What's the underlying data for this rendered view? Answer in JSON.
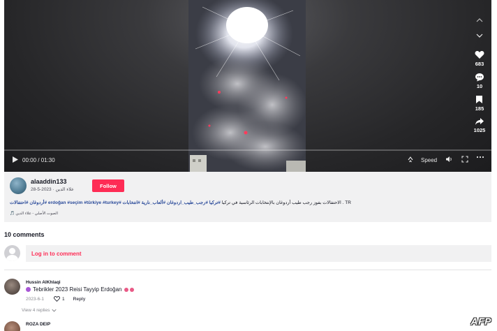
{
  "video": {
    "time_display": "00:00 / 01:30",
    "speed_label": "Speed",
    "progress": 0.0
  },
  "actions": {
    "likes": "683",
    "comments": "10",
    "saves": "185",
    "shares": "1025"
  },
  "author": {
    "username": "alaaddin133",
    "nickname_date": "علاء الدين · 2023-5-28",
    "follow_label": "Follow",
    "description_prefix": "TR . الاحتفالات بفوز رجب طيب أردوغان بالإنتخابات الرئاسية في تركيا",
    "hashtags": [
      "#تركيا",
      "#رجب_طيب_اردوغان",
      "#ألعاب_نارية",
      "#انتخابات",
      "#erdoğan",
      "#seçim",
      "#türkiye",
      "#turkey",
      "#أردوغان",
      "#احتفالات"
    ],
    "music": "الصوت الأصلي - علاء الدين 🎵"
  },
  "comments": {
    "title": "10 comments",
    "login_prompt": "Log in to comment",
    "items": [
      {
        "user": "Hussin AlKhlaqi",
        "text": "Tebrikler 2023 Reisi Tayyip Erdoğan",
        "date": "2023-6-1",
        "likes": "1",
        "reply_label": "Reply",
        "view_replies": "View 4 replies"
      },
      {
        "user": "ROZA DEIP"
      }
    ]
  },
  "watermark": "AFP"
}
